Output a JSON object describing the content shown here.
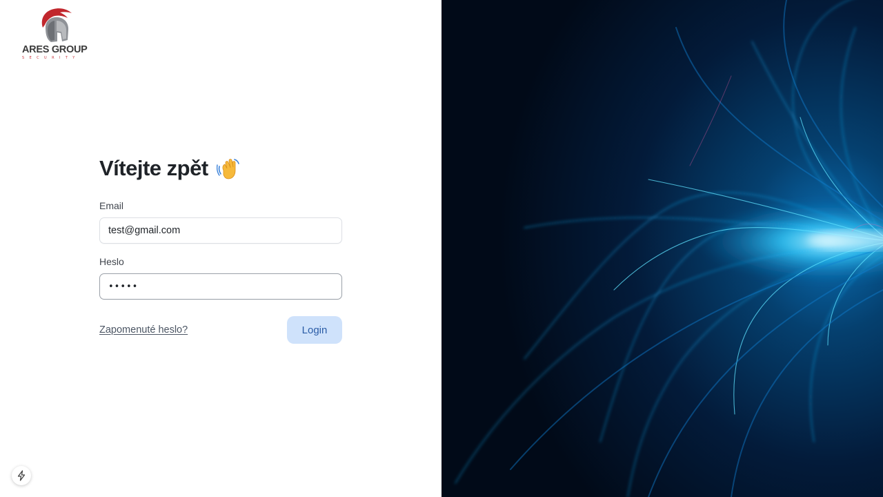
{
  "brand": {
    "name": "ARES GROUP",
    "subtitle": "SECURITY",
    "accent_color": "#c1272d"
  },
  "login_form": {
    "title": "Vítejte zpět",
    "title_icon": "waving-hand-icon",
    "email": {
      "label": "Email",
      "value": "test@gmail.com"
    },
    "password": {
      "label": "Heslo",
      "value": "•••••"
    },
    "forgot_link": "Zapomenuté heslo?",
    "login_button": "Login",
    "button_color": "#cfe2fb"
  },
  "hero": {
    "icon": "blue-light-fibers-background",
    "base_color": "#02122a",
    "glow_color": "#19c8ff"
  },
  "dev_badge": {
    "icon": "lightning-bolt-icon"
  }
}
